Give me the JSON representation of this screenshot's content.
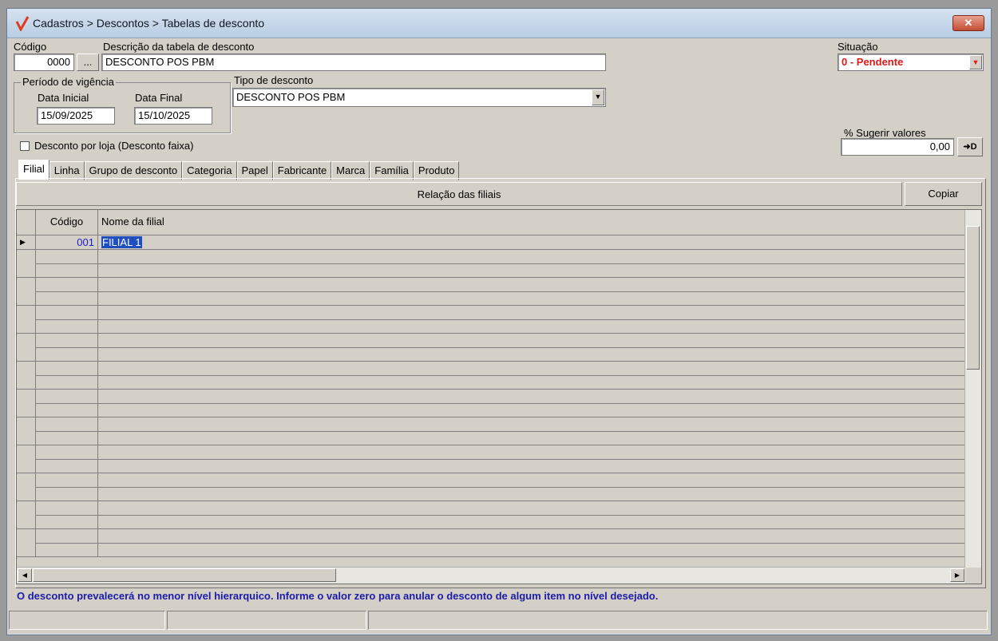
{
  "window": {
    "breadcrumb": "Cadastros > Descontos > Tabelas de desconto",
    "close_label": "✕"
  },
  "form": {
    "codigo_label": "Código",
    "codigo_value": "0000",
    "ellipsis_label": "...",
    "descricao_label": "Descrição da tabela de desconto",
    "descricao_value": "DESCONTO POS PBM",
    "situacao_label": "Situação",
    "situacao_value": "0 - Pendente",
    "periodo_label": "Período de vigência",
    "data_inicial_label": "Data Inicial",
    "data_inicial_value": "15/09/2025",
    "data_final_label": "Data Final",
    "data_final_value": "15/10/2025",
    "tipo_label": "Tipo de desconto",
    "tipo_value": "DESCONTO POS PBM",
    "sugerir_label": "% Sugerir valores",
    "sugerir_value": "0,00",
    "sugerir_btn": "➜D",
    "loja_checkbox_label": "Desconto por loja (Desconto faixa)"
  },
  "tabs": [
    {
      "label": "Filial"
    },
    {
      "label": "Linha"
    },
    {
      "label": "Grupo de desconto"
    },
    {
      "label": "Categoria"
    },
    {
      "label": "Papel"
    },
    {
      "label": "Fabricante"
    },
    {
      "label": "Marca"
    },
    {
      "label": "Família"
    },
    {
      "label": "Produto"
    }
  ],
  "grid": {
    "header_bar": "Relação das filiais",
    "copy_button": "Copiar",
    "col_codigo": "Código",
    "col_nome": "Nome da filial",
    "rows": [
      {
        "codigo": "001",
        "nome": "FILIAL 1"
      }
    ]
  },
  "footer": {
    "info": "O desconto prevalecerá no menor nível hierarquico. Informe o valor zero para anular o desconto de algum item no nível desejado."
  },
  "colors": {
    "situacao_text": "#e01818",
    "info_text": "#1c1ca8",
    "selection": "#1f4fbf"
  }
}
